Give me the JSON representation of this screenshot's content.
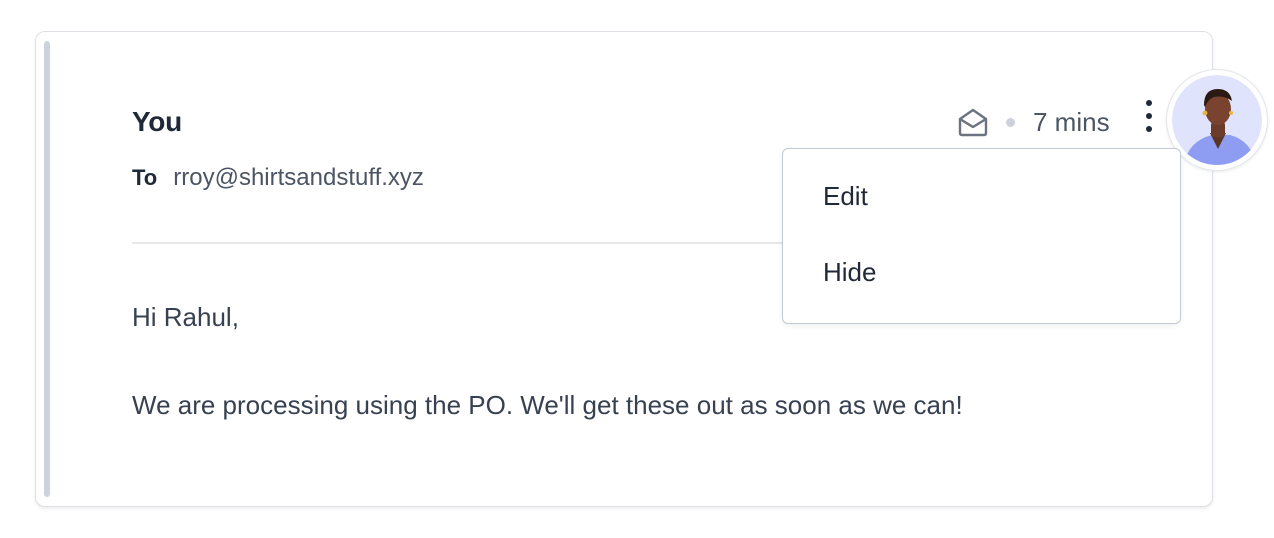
{
  "message": {
    "sender": "You",
    "to_label": "To",
    "to_address": "rroy@shirtsandstuff.xyz",
    "time": "7 mins",
    "body_greeting": "Hi Rahul,",
    "body_text": "We are processing using the PO. We'll get these out as soon as we can!"
  },
  "menu": {
    "items": [
      {
        "label": "Edit"
      },
      {
        "label": "Hide"
      }
    ]
  },
  "icons": {
    "status": "envelope-open-icon",
    "more": "kebab-menu-icon"
  },
  "colors": {
    "accent_bar": "#cdd3de",
    "avatar_bg": "#8e9df2"
  }
}
